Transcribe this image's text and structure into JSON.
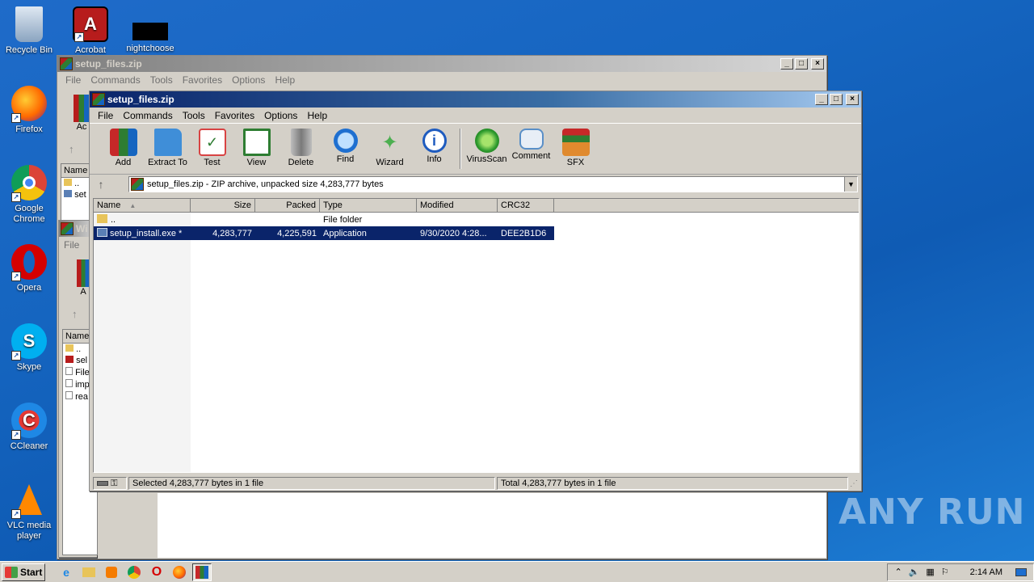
{
  "desktop": {
    "icons": [
      {
        "label": "Recycle Bin",
        "icon": "recycle-bin-icon"
      },
      {
        "label": "Acrobat",
        "icon": "acrobat-icon"
      },
      {
        "label": "nightchoose",
        "icon": "file-icon"
      },
      {
        "label": "Firefox",
        "icon": "firefox-icon"
      },
      {
        "label": "Google Chrome",
        "icon": "chrome-icon"
      },
      {
        "label": "Opera",
        "icon": "opera-icon"
      },
      {
        "label": "Skype",
        "icon": "skype-icon"
      },
      {
        "label": "CCleaner",
        "icon": "ccleaner-icon"
      },
      {
        "label": "VLC media player",
        "icon": "vlc-icon"
      }
    ],
    "watermark": "ANY RUN"
  },
  "back_window": {
    "title": "setup_files.zip",
    "menu": [
      "File",
      "Commands",
      "Tools",
      "Favorites",
      "Options",
      "Help"
    ],
    "partial_toolbar_label": "Ac",
    "partial_header": "Name",
    "partial_rows": [
      "..",
      "set"
    ]
  },
  "third_window": {
    "title": "Wi",
    "menu_first": "File",
    "partial_toolbar_label": "A",
    "partial_header": "Name",
    "partial_rows": [
      "..",
      "sel",
      "File",
      "imp",
      "rea"
    ]
  },
  "main_window": {
    "title": "setup_files.zip",
    "menu": [
      "File",
      "Commands",
      "Tools",
      "Favorites",
      "Options",
      "Help"
    ],
    "toolbar": [
      {
        "label": "Add",
        "icon": "add-archive-icon",
        "color": "#c62828"
      },
      {
        "label": "Extract To",
        "icon": "extract-folder-icon",
        "color": "#3f8ed8"
      },
      {
        "label": "Test",
        "icon": "test-checklist-icon",
        "color": "#d84343"
      },
      {
        "label": "View",
        "icon": "view-book-icon",
        "color": "#2e7d32"
      },
      {
        "label": "Delete",
        "icon": "delete-trash-icon",
        "color": "#8a8a8a"
      },
      {
        "label": "Find",
        "icon": "find-magnifier-icon",
        "color": "#1e6fd0"
      },
      {
        "label": "Wizard",
        "icon": "wizard-wand-icon",
        "color": "#4caf50"
      },
      {
        "label": "Info",
        "icon": "info-icon",
        "color": "#1e5bbf"
      }
    ],
    "toolbar2": [
      {
        "label": "VirusScan",
        "icon": "virusscan-icon",
        "color": "#2e9b2e"
      },
      {
        "label": "Comment",
        "icon": "comment-icon",
        "color": "#5a8fc7"
      },
      {
        "label": "SFX",
        "icon": "sfx-box-icon",
        "color": "#e08a2e"
      }
    ],
    "address": "setup_files.zip - ZIP archive, unpacked size 4,283,777 bytes",
    "columns": [
      "Name",
      "Size",
      "Packed",
      "Type",
      "Modified",
      "CRC32"
    ],
    "rows": [
      {
        "name": "..",
        "size": "",
        "packed": "",
        "type": "File folder",
        "modified": "",
        "crc": ""
      },
      {
        "name": "setup_install.exe *",
        "size": "4,283,777",
        "packed": "4,225,591",
        "type": "Application",
        "modified": "9/30/2020 4:28...",
        "crc": "DEE2B1D6"
      }
    ],
    "status_left": "Selected 4,283,777 bytes in 1 file",
    "status_right": "Total 4,283,777 bytes in 1 file"
  },
  "taskbar": {
    "start_label": "Start",
    "clock": "2:14 AM"
  }
}
